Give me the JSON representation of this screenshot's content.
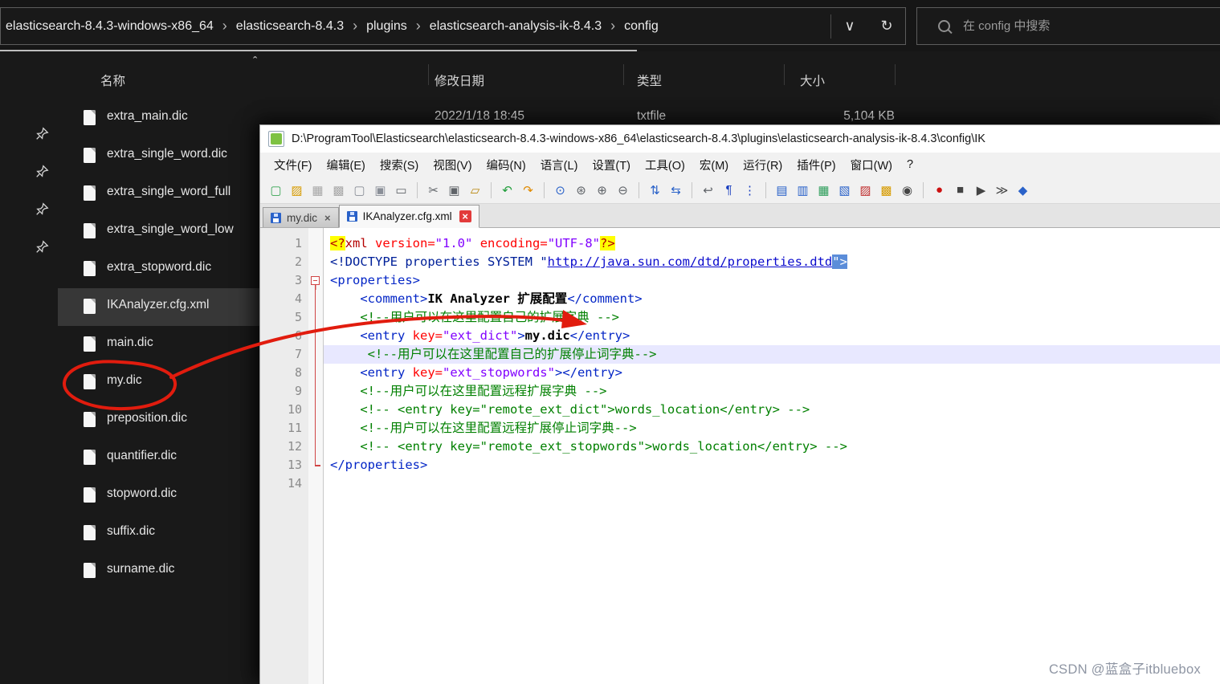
{
  "explorer": {
    "breadcrumb": [
      "elasticsearch-8.4.3-windows-x86_64",
      "elasticsearch-8.4.3",
      "plugins",
      "elasticsearch-analysis-ik-8.4.3",
      "config"
    ],
    "icons": {
      "dropdown_glyph": "∨",
      "refresh_glyph": "↻",
      "breadcrumb_separator": "›"
    },
    "search_placeholder": "在 config 中搜索",
    "sort_indicator": "ˆ",
    "columns": [
      {
        "key": "name",
        "label": "名称"
      },
      {
        "key": "date",
        "label": "修改日期"
      },
      {
        "key": "type",
        "label": "类型"
      },
      {
        "key": "size",
        "label": "大小"
      }
    ],
    "files": [
      {
        "name": "extra_main.dic",
        "date": "2022/1/18 18:45",
        "type": "txtfile",
        "size": "5,104 KB"
      },
      {
        "name": "extra_single_word.dic"
      },
      {
        "name": "extra_single_word_full"
      },
      {
        "name": "extra_single_word_low"
      },
      {
        "name": "extra_stopword.dic"
      },
      {
        "name": "IKAnalyzer.cfg.xml",
        "selected": true
      },
      {
        "name": "main.dic"
      },
      {
        "name": "my.dic"
      },
      {
        "name": "preposition.dic"
      },
      {
        "name": "quantifier.dic"
      },
      {
        "name": "stopword.dic"
      },
      {
        "name": "suffix.dic"
      },
      {
        "name": "surname.dic"
      }
    ]
  },
  "notepad": {
    "title": "D:\\ProgramTool\\Elasticsearch\\elasticsearch-8.4.3-windows-x86_64\\elasticsearch-8.4.3\\plugins\\elasticsearch-analysis-ik-8.4.3\\config\\IK",
    "menus": [
      "文件(F)",
      "编辑(E)",
      "搜索(S)",
      "视图(V)",
      "编码(N)",
      "语言(L)",
      "设置(T)",
      "工具(O)",
      "宏(M)",
      "运行(R)",
      "插件(P)",
      "窗口(W)",
      "?"
    ],
    "toolbar": [
      {
        "name": "new-file",
        "glyph": "▢",
        "color": "#3aa655"
      },
      {
        "name": "open-folder",
        "glyph": "▨",
        "color": "#d79b00"
      },
      {
        "name": "save",
        "glyph": "▦",
        "color": "#a7a7a7"
      },
      {
        "name": "save-all",
        "glyph": "▩",
        "color": "#a7a7a7"
      },
      {
        "name": "close",
        "glyph": "▢",
        "color": "#8a8f98"
      },
      {
        "name": "close-all",
        "glyph": "▣",
        "color": "#8a8f98"
      },
      {
        "name": "print",
        "glyph": "▭",
        "color": "#5f6368"
      },
      {
        "sep": true
      },
      {
        "name": "cut",
        "glyph": "✂",
        "color": "#5f6368"
      },
      {
        "name": "copy",
        "glyph": "▣",
        "color": "#5f6368"
      },
      {
        "name": "paste",
        "glyph": "▱",
        "color": "#b8860b"
      },
      {
        "sep": true
      },
      {
        "name": "undo",
        "glyph": "↶",
        "color": "#1f9d3a"
      },
      {
        "name": "redo",
        "glyph": "↷",
        "color": "#e08a00"
      },
      {
        "sep": true
      },
      {
        "name": "find",
        "glyph": "⊙",
        "color": "#2a62c9"
      },
      {
        "name": "replace",
        "glyph": "⊛",
        "color": "#5f6368"
      },
      {
        "name": "zoom-in",
        "glyph": "⊕",
        "color": "#5f6368"
      },
      {
        "name": "zoom-out",
        "glyph": "⊖",
        "color": "#5f6368"
      },
      {
        "sep": true
      },
      {
        "name": "sync-vertical-scroll",
        "glyph": "⇅",
        "color": "#2a62c9"
      },
      {
        "name": "sync-horizontal-scroll",
        "glyph": "⇆",
        "color": "#2a62c9"
      },
      {
        "sep": true
      },
      {
        "name": "word-wrap",
        "glyph": "↩",
        "color": "#5f6368"
      },
      {
        "name": "show-all-characters",
        "glyph": "¶",
        "color": "#1a3fbf"
      },
      {
        "name": "indent-guide",
        "glyph": "⋮",
        "color": "#1a3fbf"
      },
      {
        "sep": true
      },
      {
        "name": "function-list",
        "glyph": "▤",
        "color": "#2a62c9"
      },
      {
        "name": "document-map",
        "glyph": "▥",
        "color": "#2a62c9"
      },
      {
        "name": "document-list",
        "glyph": "▦",
        "color": "#2e9e5b"
      },
      {
        "name": "folder-as-workspace",
        "glyph": "▧",
        "color": "#2a62c9"
      },
      {
        "name": "user-defined-language",
        "glyph": "▨",
        "color": "#c03030"
      },
      {
        "name": "file-browser",
        "glyph": "▩",
        "color": "#d79b00"
      },
      {
        "name": "monitoring",
        "glyph": "◉",
        "color": "#444444"
      },
      {
        "sep": true
      },
      {
        "name": "start-recording",
        "glyph": "●",
        "color": "#cc1111"
      },
      {
        "name": "stop-recording",
        "glyph": "■",
        "color": "#444444"
      },
      {
        "name": "playback-macro",
        "glyph": "▶",
        "color": "#444444"
      },
      {
        "name": "run-macro-multiple",
        "glyph": "≫",
        "color": "#444444"
      },
      {
        "name": "save-macro",
        "glyph": "◆",
        "color": "#2a62c9"
      }
    ],
    "tabs": [
      {
        "label": "my.dic",
        "active": false
      },
      {
        "label": "IKAnalyzer.cfg.xml",
        "active": true
      }
    ],
    "tab_close_glyph": "×",
    "editor": {
      "lines": [
        {
          "num": 1,
          "fold": "",
          "segs": [
            {
              "t": "<?",
              "c": "pi ym"
            },
            {
              "t": "xml",
              "c": "pi"
            },
            {
              "t": " ",
              "c": ""
            },
            {
              "t": "version=",
              "c": "attr"
            },
            {
              "t": "\"1.0\"",
              "c": "val"
            },
            {
              "t": " ",
              "c": ""
            },
            {
              "t": "encoding=",
              "c": "attr"
            },
            {
              "t": "\"UTF-8\"",
              "c": "val"
            },
            {
              "t": "?>",
              "c": "pi ym"
            }
          ]
        },
        {
          "num": 2,
          "fold": "",
          "segs": [
            {
              "t": "<!",
              "c": "doc"
            },
            {
              "t": "DOCTYPE properties SYSTEM ",
              "c": "doc"
            },
            {
              "t": "\"",
              "c": "doc"
            },
            {
              "t": "http://java.sun.com/dtd/properties.dtd",
              "c": "url"
            },
            {
              "t": "\">",
              "c": "doc tm"
            }
          ]
        },
        {
          "num": 3,
          "fold": "start",
          "segs": [
            {
              "t": "<properties>",
              "c": "tag"
            }
          ]
        },
        {
          "num": 4,
          "fold": "mid",
          "segs": [
            {
              "t": "    ",
              "c": ""
            },
            {
              "t": "<comment>",
              "c": "tag"
            },
            {
              "t": "IK Analyzer 扩展配置",
              "c": "bold"
            },
            {
              "t": "</comment>",
              "c": "tag"
            }
          ]
        },
        {
          "num": 5,
          "fold": "mid",
          "segs": [
            {
              "t": "    ",
              "c": ""
            },
            {
              "t": "<!--用户可以在这里配置自己的扩展字典 -->",
              "c": "com"
            }
          ]
        },
        {
          "num": 6,
          "fold": "mid",
          "segs": [
            {
              "t": "    ",
              "c": ""
            },
            {
              "t": "<entry ",
              "c": "tag"
            },
            {
              "t": "key=",
              "c": "attr"
            },
            {
              "t": "\"ext_dict\"",
              "c": "val"
            },
            {
              "t": ">",
              "c": "tag"
            },
            {
              "t": "my.dic",
              "c": "bold"
            },
            {
              "t": "</entry>",
              "c": "tag"
            }
          ]
        },
        {
          "num": 7,
          "fold": "mid",
          "cur": true,
          "segs": [
            {
              "t": "     ",
              "c": ""
            },
            {
              "t": "<!--用户可以在这里配置自己的扩展停止词字典-->",
              "c": "com"
            }
          ]
        },
        {
          "num": 8,
          "fold": "mid",
          "segs": [
            {
              "t": "    ",
              "c": ""
            },
            {
              "t": "<entry ",
              "c": "tag"
            },
            {
              "t": "key=",
              "c": "attr"
            },
            {
              "t": "\"ext_stopwords\"",
              "c": "val"
            },
            {
              "t": ">",
              "c": "tag"
            },
            {
              "t": "</entry>",
              "c": "tag"
            }
          ]
        },
        {
          "num": 9,
          "fold": "mid",
          "segs": [
            {
              "t": "    ",
              "c": ""
            },
            {
              "t": "<!--用户可以在这里配置远程扩展字典 -->",
              "c": "com"
            }
          ]
        },
        {
          "num": 10,
          "fold": "mid",
          "segs": [
            {
              "t": "    ",
              "c": ""
            },
            {
              "t": "<!-- <entry key=\"remote_ext_dict\">words_location</entry> -->",
              "c": "com"
            }
          ]
        },
        {
          "num": 11,
          "fold": "mid",
          "segs": [
            {
              "t": "    ",
              "c": ""
            },
            {
              "t": "<!--用户可以在这里配置远程扩展停止词字典-->",
              "c": "com"
            }
          ]
        },
        {
          "num": 12,
          "fold": "mid",
          "segs": [
            {
              "t": "    ",
              "c": ""
            },
            {
              "t": "<!-- <entry key=\"remote_ext_stopwords\">words_location</entry> -->",
              "c": "com"
            }
          ]
        },
        {
          "num": 13,
          "fold": "end",
          "segs": [
            {
              "t": "</properties>",
              "c": "tag"
            }
          ]
        },
        {
          "num": 14,
          "fold": "",
          "segs": []
        }
      ]
    }
  },
  "watermark": "CSDN @蓝盒子itbluebox"
}
